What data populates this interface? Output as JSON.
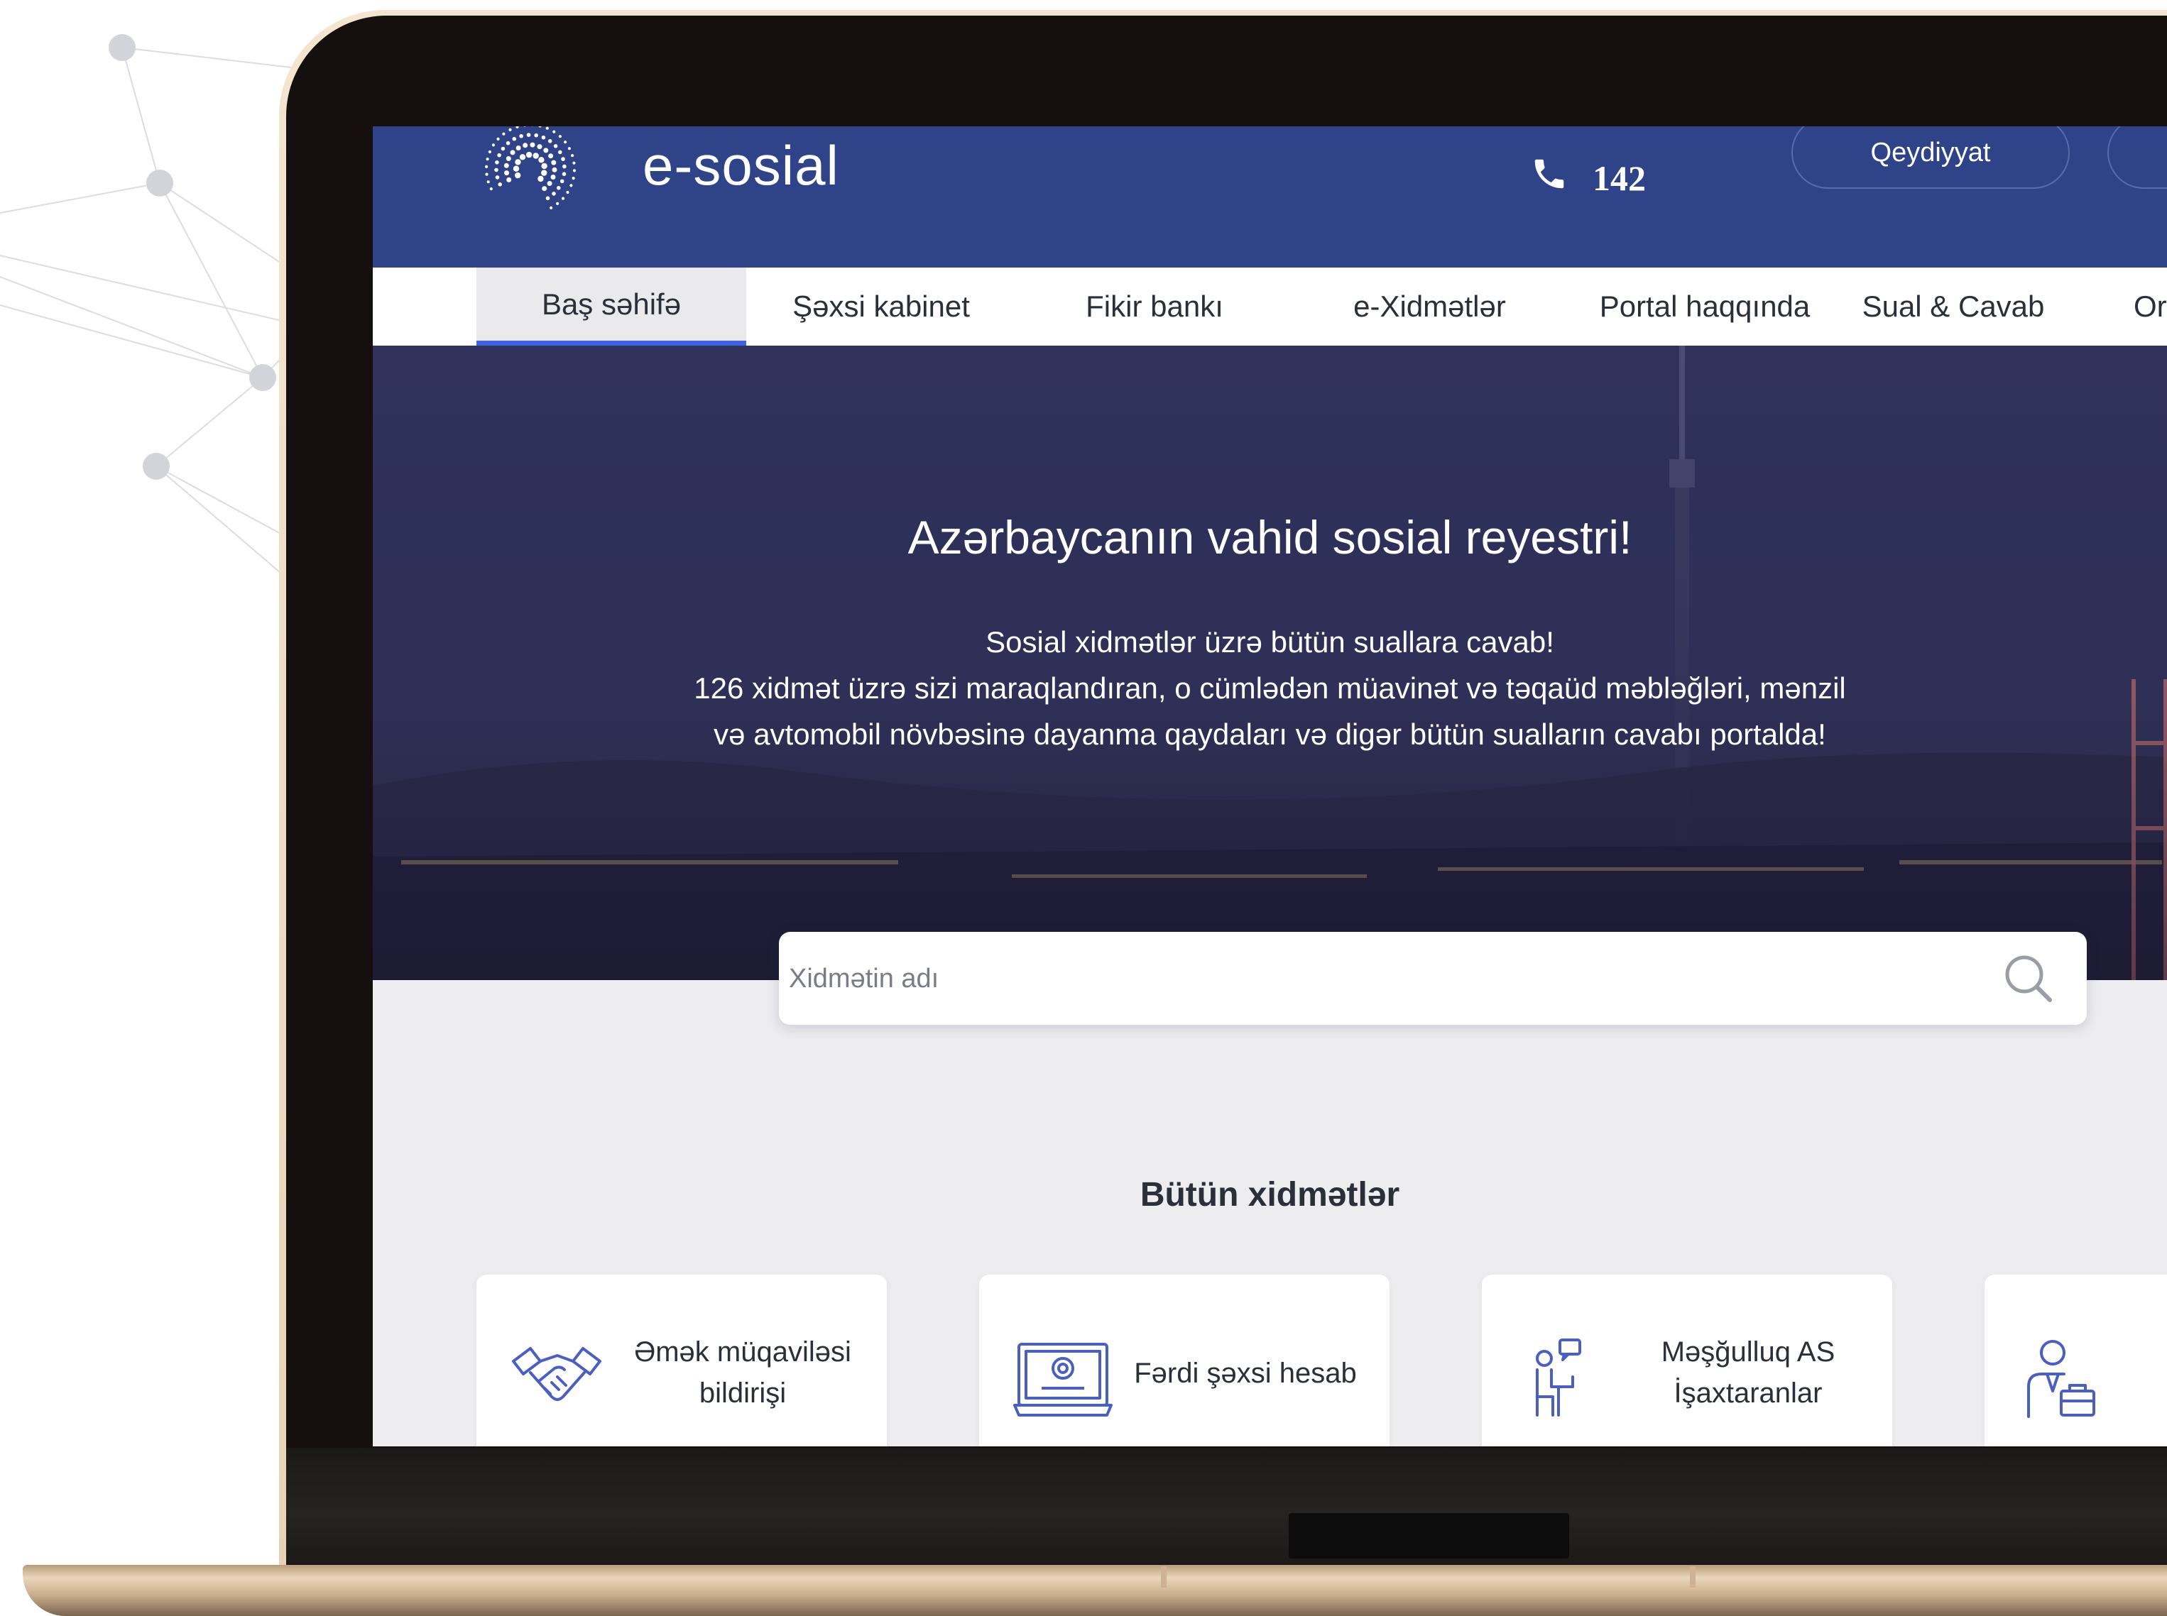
{
  "brand": {
    "name": "e-sosial"
  },
  "header": {
    "phone": "142",
    "register_label": "Qeydiyyat"
  },
  "nav": {
    "items": [
      {
        "label": "Baş səhifə",
        "active": true
      },
      {
        "label": "Şəxsi kabinet",
        "active": false
      },
      {
        "label": "Fikir bankı",
        "active": false
      },
      {
        "label": "e-Xidmətlər",
        "active": false
      },
      {
        "label": "Portal haqqında",
        "active": false
      },
      {
        "label": "Sual & Cavab",
        "active": false
      },
      {
        "label": "Or",
        "active": false
      }
    ]
  },
  "hero": {
    "title": "Azərbaycanın vahid sosial reyestri!",
    "lines": [
      "Sosial xidmətlər üzrə bütün suallara cavab!",
      "126 xidmət üzrə sizi maraqlandıran, o cümlədən müavinət və təqaüd məbləğləri, mənzil",
      "və avtomobil növbəsinə dayanma qaydaları və digər bütün sualların cavabı portalda!"
    ],
    "slides": 3,
    "active_slide": 2
  },
  "search": {
    "placeholder": "Xidmətin adı"
  },
  "services": {
    "title": "Bütün xidmətlər",
    "cards": [
      {
        "label_line1": "Əmək müqaviləsi",
        "label_line2": "bildirişi",
        "icon": "handshake-icon"
      },
      {
        "label_line1": "Fərdi şəxsi hesab",
        "label_line2": "",
        "icon": "laptop-account-icon"
      },
      {
        "label_line1": "Məşğulluq AS",
        "label_line2": "İşaxtaranlar",
        "icon": "job-seeker-icon"
      },
      {
        "label_line1": "",
        "label_line2": "",
        "icon": "employer-icon"
      }
    ]
  },
  "colors": {
    "header_bg": "#2f4389",
    "nav_active_underline": "#3b63e3",
    "icon_stroke": "#4a5fc4",
    "page_bg": "#ededef"
  }
}
